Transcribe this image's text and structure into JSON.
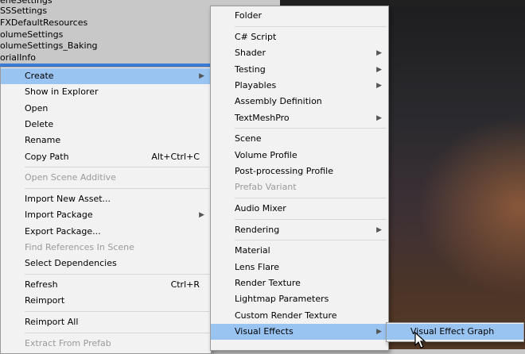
{
  "project_assets": [
    "eneSettings",
    "SSSettings",
    "FXDefaultResources",
    "olumeSettings",
    "olumeSettings_Baking",
    "orialInfo"
  ],
  "context_menu": {
    "items": [
      {
        "label": "Create",
        "has_submenu": true,
        "highlighted": true
      },
      {
        "label": "Show in Explorer"
      },
      {
        "label": "Open"
      },
      {
        "label": "Delete"
      },
      {
        "label": "Rename"
      },
      {
        "label": "Copy Path",
        "shortcut": "Alt+Ctrl+C"
      },
      {
        "label": "Open Scene Additive",
        "disabled": true
      },
      {
        "label": "Import New Asset..."
      },
      {
        "label": "Import Package",
        "has_submenu": true
      },
      {
        "label": "Export Package..."
      },
      {
        "label": "Find References In Scene",
        "disabled": true
      },
      {
        "label": "Select Dependencies"
      },
      {
        "label": "Refresh",
        "shortcut": "Ctrl+R"
      },
      {
        "label": "Reimport"
      },
      {
        "label": "Reimport All"
      },
      {
        "label": "Extract From Prefab",
        "disabled": true
      }
    ]
  },
  "create_menu": {
    "items": [
      {
        "label": "Folder"
      },
      {
        "label": "C# Script"
      },
      {
        "label": "Shader",
        "has_submenu": true
      },
      {
        "label": "Testing",
        "has_submenu": true
      },
      {
        "label": "Playables",
        "has_submenu": true
      },
      {
        "label": "Assembly Definition"
      },
      {
        "label": "TextMeshPro",
        "has_submenu": true
      },
      {
        "label": "Scene"
      },
      {
        "label": "Volume Profile"
      },
      {
        "label": "Post-processing Profile"
      },
      {
        "label": "Prefab Variant",
        "disabled": true
      },
      {
        "label": "Audio Mixer"
      },
      {
        "label": "Rendering",
        "has_submenu": true
      },
      {
        "label": "Material"
      },
      {
        "label": "Lens Flare"
      },
      {
        "label": "Render Texture"
      },
      {
        "label": "Lightmap Parameters"
      },
      {
        "label": "Custom Render Texture"
      },
      {
        "label": "Visual Effects",
        "has_submenu": true,
        "highlighted": true
      }
    ]
  },
  "visual_effects_menu": {
    "items": [
      {
        "label": "Visual Effect Graph",
        "highlighted": true
      }
    ]
  },
  "icons": {
    "submenu_arrow": "chevron-right-icon",
    "cursor": "mouse-pointer-icon"
  },
  "colors": {
    "highlight": "#99c3f0",
    "menu_bg": "#f2f2f2",
    "disabled_text": "#9a9a9a",
    "selection": "#3c7cd6"
  }
}
